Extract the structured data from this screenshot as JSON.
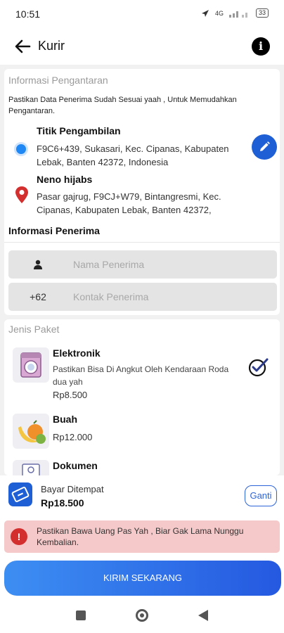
{
  "status_bar": {
    "time": "10:51",
    "network": "4G",
    "battery": "33"
  },
  "app_bar": {
    "title": "Kurir"
  },
  "delivery_info": {
    "section_title": "Informasi Pengantaran",
    "note": "Pastikan Data Penerima Sudah Sesuai yaah , Untuk Memudahkan Pengantaran.",
    "pickup": {
      "name": "Titik Pengambilan",
      "address": "F9C6+439, Sukasari, Kec. Cipanas, Kabupaten Lebak, Banten 42372, Indonesia"
    },
    "dropoff": {
      "name": "Neno hijabs",
      "address": "Pasar gajrug, F9CJ+W79, Bintangresmi, Kec. Cipanas, Kabupaten Lebak, Banten 42372,"
    }
  },
  "receiver": {
    "section_title": "Informasi Penerima",
    "name_placeholder": "Nama Penerima",
    "phone_prefix": "+62",
    "phone_placeholder": "Kontak Penerima"
  },
  "packages": {
    "section_title": "Jenis Paket",
    "items": [
      {
        "name": "Elektronik",
        "desc": "Pastikan Bisa Di Angkut Oleh Kendaraan Roda dua yah",
        "price": "Rp8.500",
        "selected": true
      },
      {
        "name": "Buah",
        "price": "Rp12.000"
      },
      {
        "name": "Dokumen"
      }
    ]
  },
  "payment": {
    "method": "Bayar Ditempat",
    "amount": "Rp18.500",
    "change_label": "Ganti"
  },
  "alert": {
    "message": "Pastikan Bawa Uang Pas Yah , Biar Gak Lama Nunggu Kembalian."
  },
  "submit": {
    "label": "KIRIM SEKARANG"
  },
  "colors": {
    "primary": "#1e5fd6",
    "alert_bg": "#f5c9c9",
    "alert_icon": "#d32f2f",
    "pickup_dot": "#1f88f5"
  }
}
